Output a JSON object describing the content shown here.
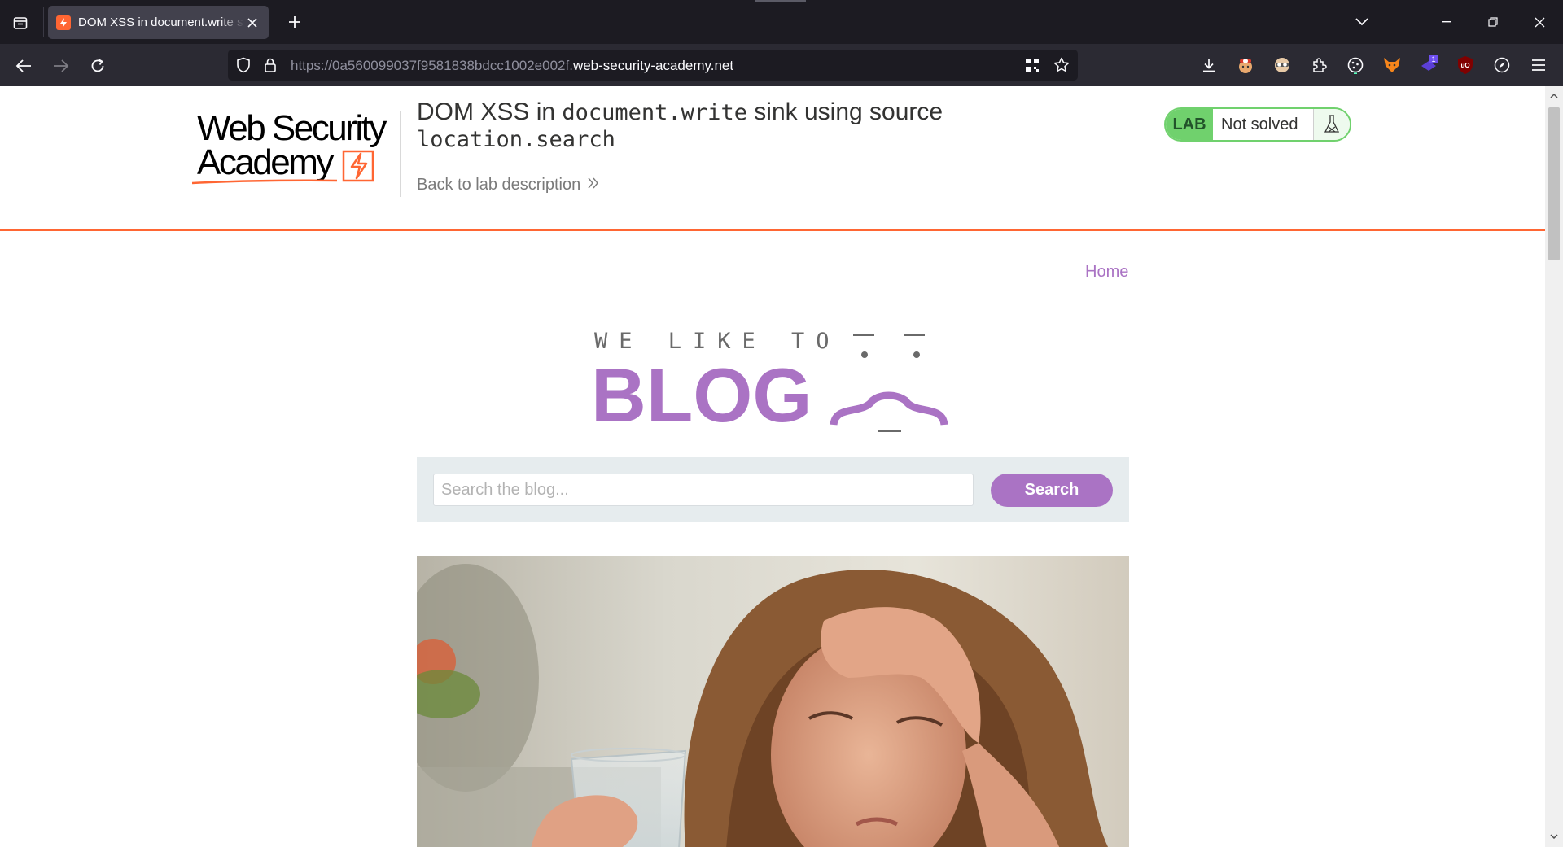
{
  "browser": {
    "tab": {
      "title": "DOM XSS in document.write sink using source location.search"
    },
    "url": {
      "prefix": "https://0a560099037f9581838bdcc1002e002f.",
      "domain": "web-security-academy.net"
    },
    "extension_badge": "1",
    "ublock_label": "uO"
  },
  "lab": {
    "title_text_1": "DOM XSS in ",
    "title_code_1": "document.write",
    "title_text_2": " sink using source",
    "title_code_2": "location.search",
    "back_link": "Back to lab description",
    "status_badge": "LAB",
    "status_text": "Not solved"
  },
  "logo": {
    "line1": "Web Security",
    "line2": "Academy"
  },
  "blog": {
    "nav_home": "Home",
    "hero_top": "WE LIKE TO",
    "hero_main": "BLOG",
    "search_placeholder": "Search the blog...",
    "search_button": "Search"
  },
  "colors": {
    "accent_orange": "#ff6633",
    "lab_green": "#70d16d",
    "blog_purple": "#aa73c4"
  },
  "icons": {
    "tab_list": "tab-list-icon",
    "favicon": "lightning-icon",
    "close_tab": "close-icon",
    "new_tab": "plus-icon",
    "back": "arrow-left-icon",
    "forward": "arrow-right-icon",
    "reload": "reload-icon",
    "shield": "shield-icon",
    "lock": "lock-icon",
    "qr": "qr-code-icon",
    "bookmark": "star-icon",
    "downloads": "download-icon",
    "extensions": "puzzle-icon",
    "menu": "hamburger-menu-icon",
    "flask": "flask-icon",
    "back_chevrons": "double-chevron-right-icon"
  }
}
